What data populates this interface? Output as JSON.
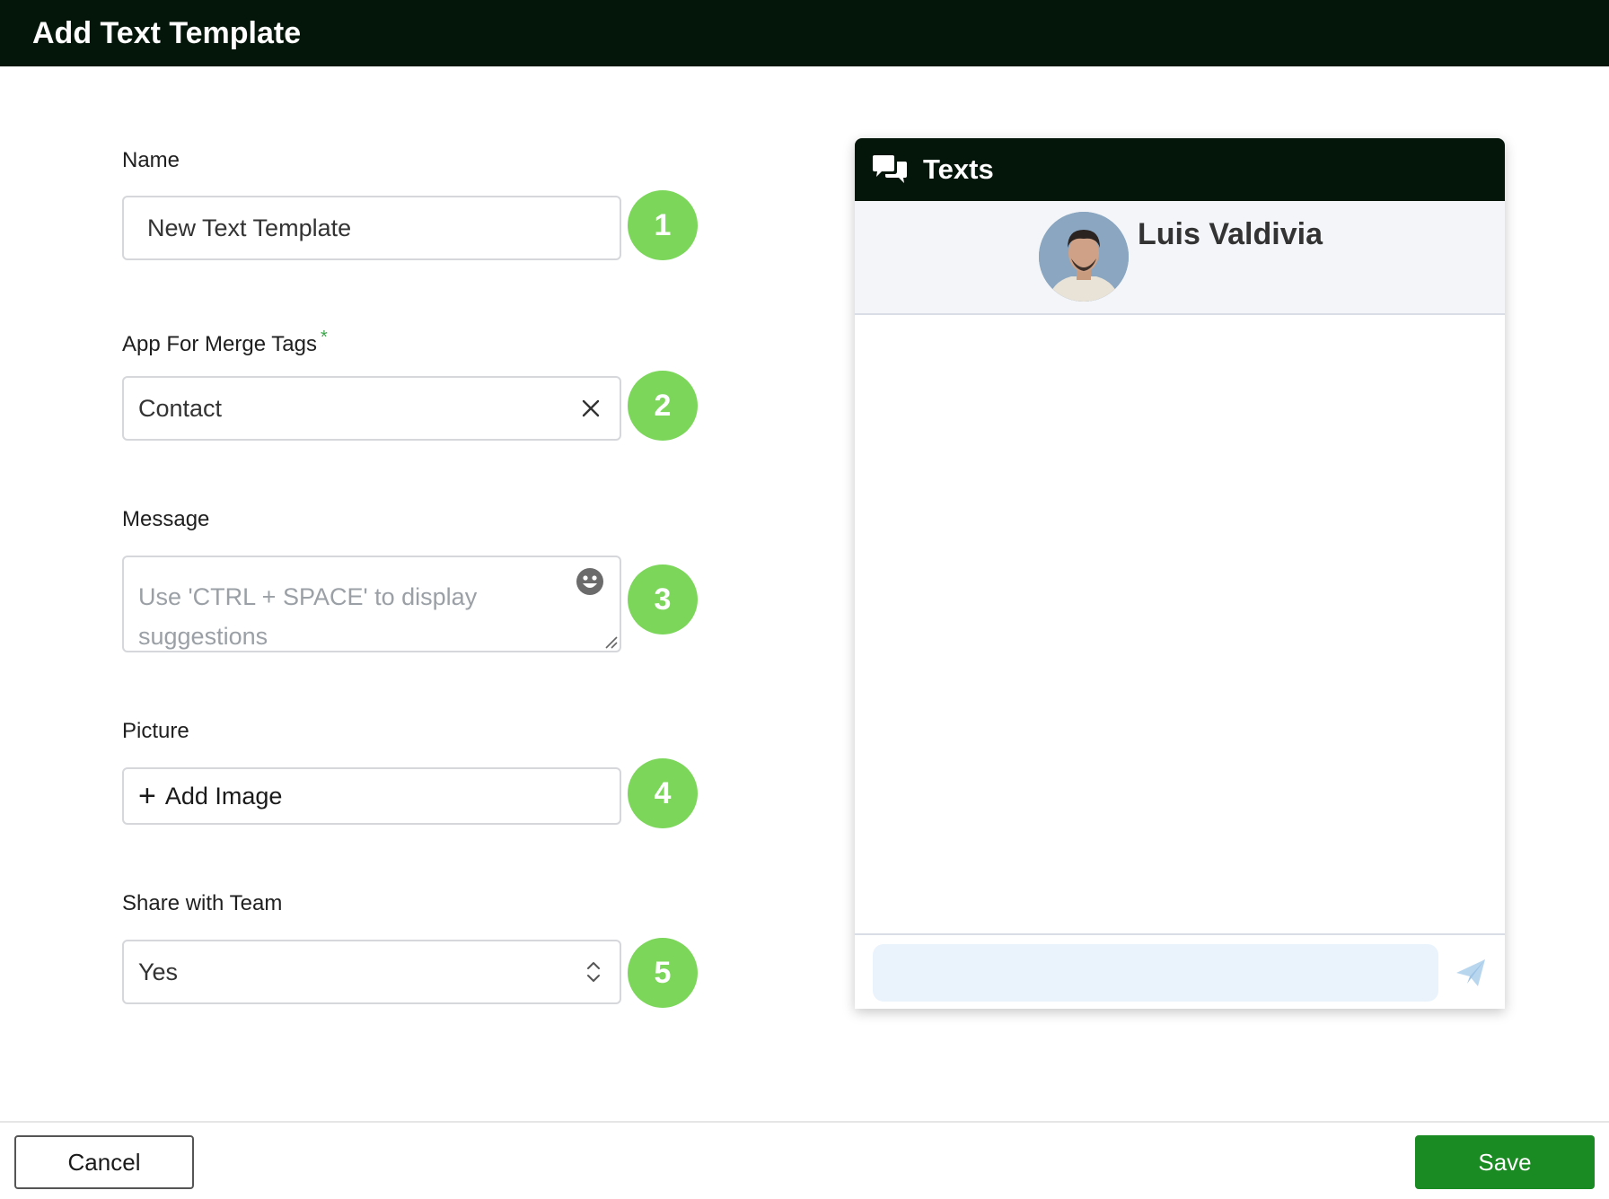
{
  "window": {
    "title": "Add Text Template"
  },
  "form": {
    "name": {
      "label": "Name",
      "value": "New Text Template",
      "badge": "1"
    },
    "app": {
      "label": "App For Merge Tags",
      "required_mark": "*",
      "value": "Contact",
      "badge": "2"
    },
    "message": {
      "label": "Message",
      "placeholder": "Use 'CTRL + SPACE' to display suggestions",
      "badge": "3"
    },
    "picture": {
      "label": "Picture",
      "button_icon": "+",
      "button_label": "Add Image",
      "badge": "4"
    },
    "share": {
      "label": "Share with Team",
      "value": "Yes",
      "badge": "5"
    }
  },
  "preview": {
    "header": "Texts",
    "contact_name": "Luis Valdivia"
  },
  "footer": {
    "cancel_label": "Cancel",
    "save_label": "Save"
  },
  "colors": {
    "titlebar": "#04150a",
    "badge": "#7bd65a",
    "save": "#1a8a22",
    "compose_input": "#eaf3fc"
  }
}
